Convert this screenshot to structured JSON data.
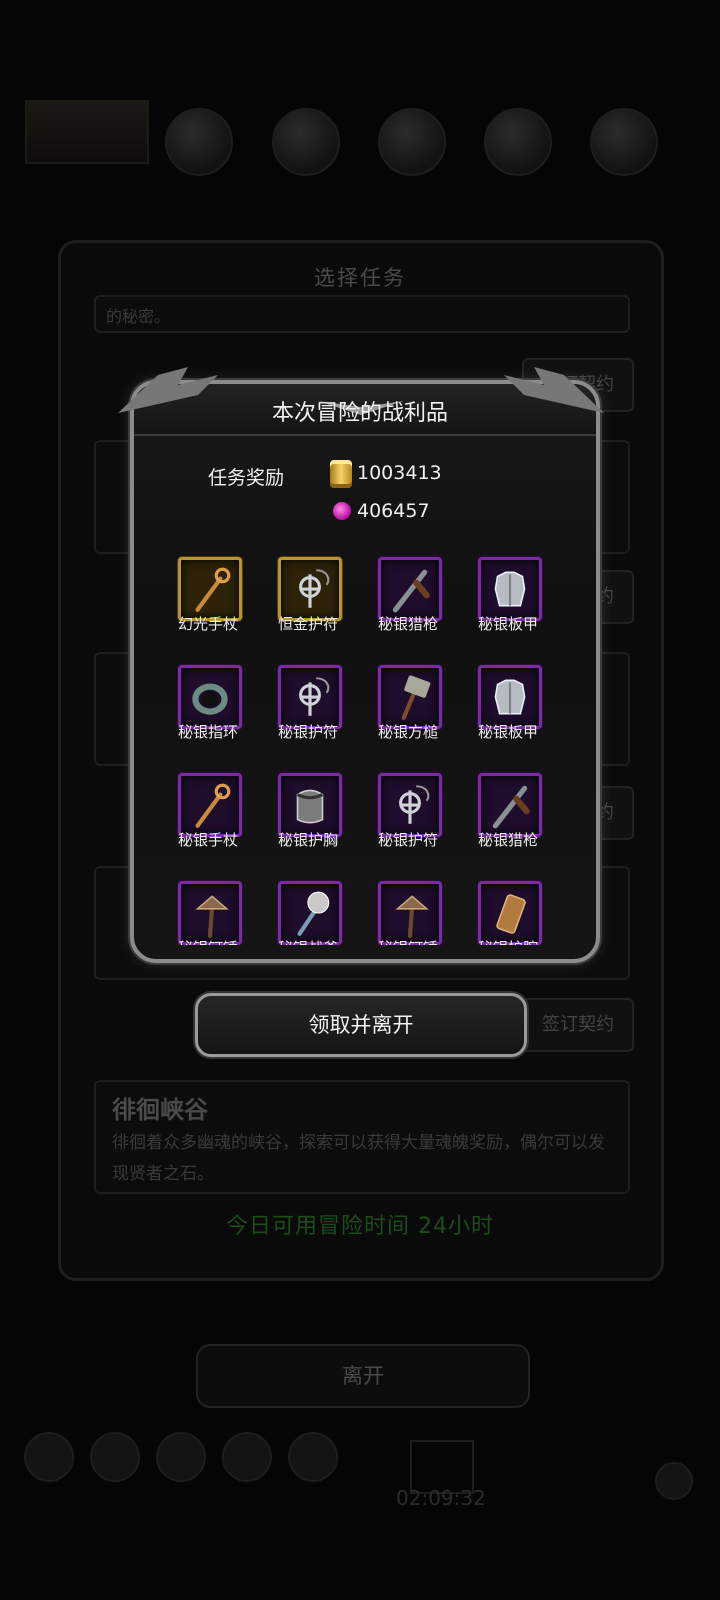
{
  "background": {
    "panel_title": "选择任务",
    "quest_top_desc": "的秘密。",
    "quests": [
      {
        "title": "",
        "desc": ""
      },
      {
        "title": "",
        "desc": ""
      },
      {
        "title": "",
        "desc": ""
      },
      {
        "title": "徘徊峡谷",
        "desc": "徘徊着众多幽魂的峡谷，探索可以获得大量魂魄奖励，偶尔可以发现贤者之石。"
      }
    ],
    "contract_buttons": [
      "签订契约",
      "签订契约",
      "签订契约",
      "签订契约",
      "签订契约"
    ],
    "available_time": "今日可用冒险时间 24小时",
    "leave_label": "离开",
    "clock": "02:09:32"
  },
  "modal": {
    "title": "本次冒险的战利品",
    "reward_label": "任务奖励",
    "gold": "1003413",
    "souls": "406457",
    "items": [
      {
        "label": "幻光手杖",
        "rarity": "gold",
        "icon": "staff-icon"
      },
      {
        "label": "恒金护符",
        "rarity": "gold",
        "icon": "amulet-icon"
      },
      {
        "label": "秘银猎枪",
        "rarity": "purple",
        "icon": "shotgun-icon"
      },
      {
        "label": "秘银板甲",
        "rarity": "purple",
        "icon": "plate-armor-icon"
      },
      {
        "label": "秘银指环",
        "rarity": "purple",
        "icon": "ring-icon"
      },
      {
        "label": "秘银护符",
        "rarity": "purple",
        "icon": "amulet-icon"
      },
      {
        "label": "秘银方槌",
        "rarity": "purple",
        "icon": "hammer-icon"
      },
      {
        "label": "秘银板甲",
        "rarity": "purple",
        "icon": "plate-armor-icon"
      },
      {
        "label": "秘银手杖",
        "rarity": "purple",
        "icon": "staff-icon"
      },
      {
        "label": "秘银护胸",
        "rarity": "purple",
        "icon": "chestguard-icon"
      },
      {
        "label": "秘银护符",
        "rarity": "purple",
        "icon": "amulet-icon"
      },
      {
        "label": "秘银猎枪",
        "rarity": "purple",
        "icon": "shotgun-icon"
      },
      {
        "label": "秘银钉锤",
        "rarity": "purple",
        "icon": "war-pick-icon"
      },
      {
        "label": "秘银战斧",
        "rarity": "purple",
        "icon": "axe-icon"
      },
      {
        "label": "秘银钉锤",
        "rarity": "purple",
        "icon": "war-pick-icon"
      },
      {
        "label": "秘银护腕",
        "rarity": "purple",
        "icon": "bracer-icon"
      }
    ],
    "claim_label": "领取并离开"
  },
  "colors": {
    "gold_frame": "#b89531",
    "purple_frame": "#7b2aa8",
    "time_green": "#1d4c1b"
  }
}
